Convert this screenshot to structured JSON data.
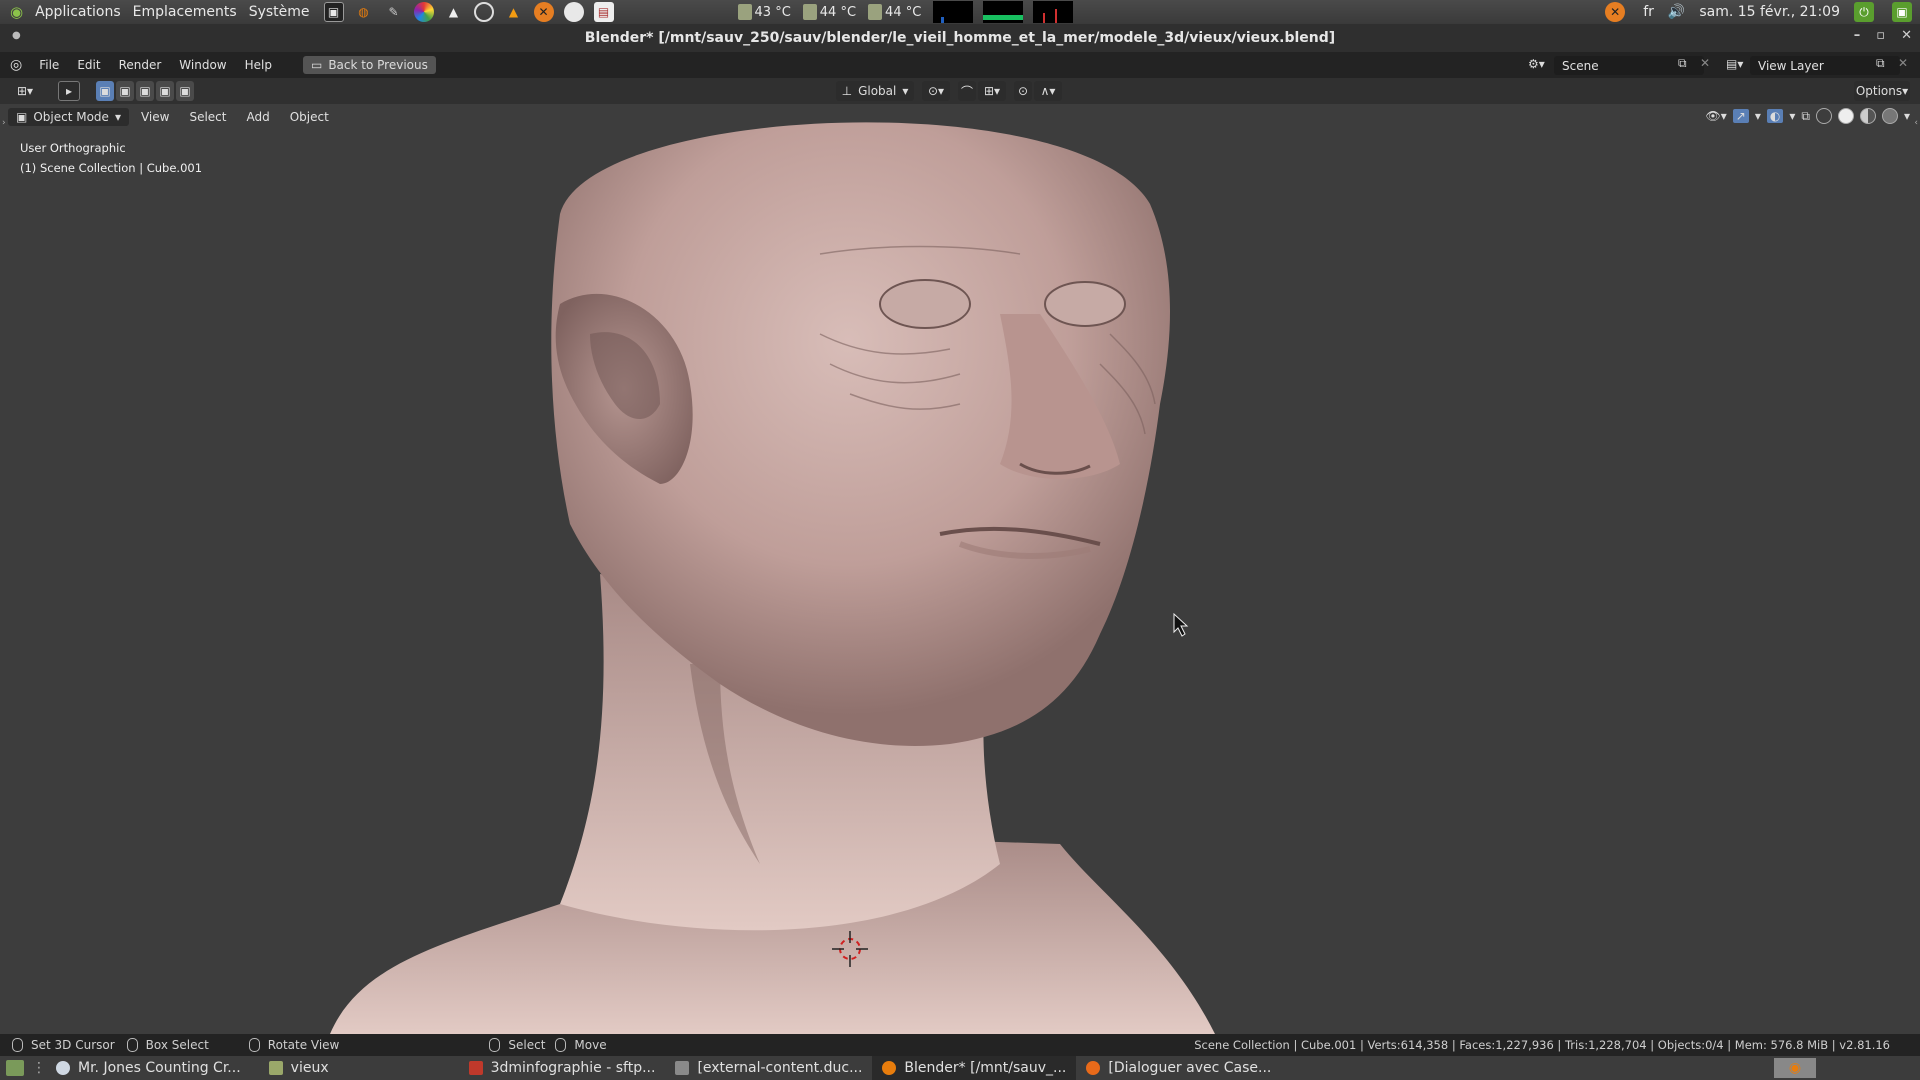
{
  "top_panel": {
    "menus": [
      "Applications",
      "Emplacements",
      "Système"
    ],
    "temps": [
      "43 °C",
      "44 °C",
      "44 °C"
    ],
    "language": "fr",
    "datetime": "sam. 15 févr., 21:09"
  },
  "window": {
    "title": "Blender* [/mnt/sauv_250/sauv/blender/le_vieil_homme_et_la_mer/modele_3d/vieux/vieux.blend]"
  },
  "blender_topbar": {
    "menus": [
      "File",
      "Edit",
      "Render",
      "Window",
      "Help"
    ],
    "back_button": "Back to Previous",
    "scene": "Scene",
    "view_layer": "View Layer"
  },
  "viewport_header": {
    "transform_orientation": "Global",
    "options_label": "Options"
  },
  "viewport": {
    "mode": "Object Mode",
    "menus": [
      "View",
      "Select",
      "Add",
      "Object"
    ],
    "view_name": "User Orthographic",
    "collection_info": "(1) Scene Collection | Cube.001"
  },
  "status_bar": {
    "hints": [
      {
        "label": "Set 3D Cursor"
      },
      {
        "label": "Box Select"
      },
      {
        "label": "Rotate View"
      },
      {
        "label": "Select"
      },
      {
        "label": "Move"
      }
    ],
    "stats": "Scene Collection | Cube.001 | Verts:614,358 | Faces:1,227,936 | Tris:1,228,704 | Objects:0/4 | Mem: 576.8 MiB | v2.81.16"
  },
  "taskbar": {
    "tasks": [
      {
        "label": "Mr. Jones Counting Cr...",
        "color": "#cfd8e3"
      },
      {
        "label": "vieux",
        "color": "#9aa86a"
      },
      {
        "label": "3dminfographie - sftp...",
        "color": "#c0392b"
      },
      {
        "label": "[external-content.duc...",
        "color": "#8a8a8a"
      },
      {
        "label": "Blender* [/mnt/sauv_...",
        "color": "#e87d0d"
      },
      {
        "label": "[Dialoguer avec Case...",
        "color": "#e86a1a"
      }
    ]
  },
  "colors": {
    "accent": "#5a7fb5",
    "blender_orange": "#e87d0d",
    "viewport_bg": "#3d3d3d",
    "skin": "#c9a9a4"
  }
}
